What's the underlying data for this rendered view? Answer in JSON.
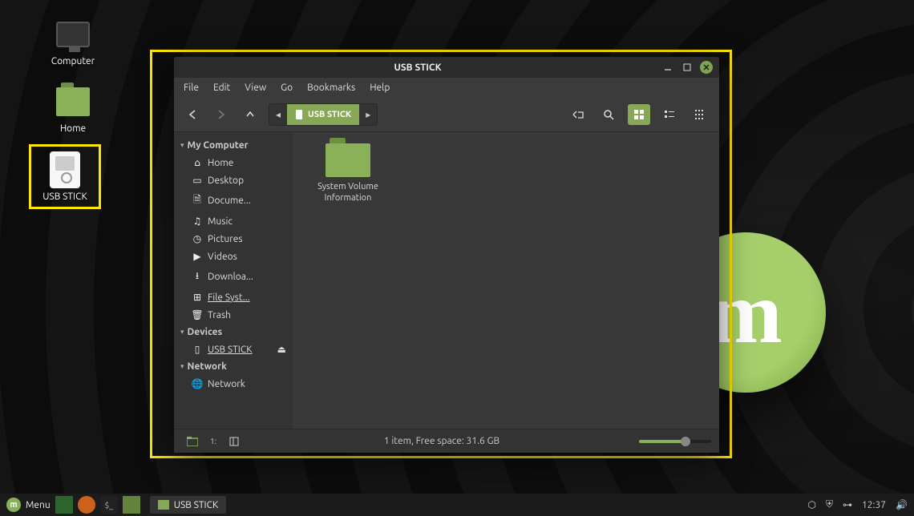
{
  "desktop": {
    "icons": [
      {
        "id": "computer",
        "label": "Computer"
      },
      {
        "id": "home",
        "label": "Home"
      },
      {
        "id": "usb",
        "label": "USB STICK"
      }
    ]
  },
  "window": {
    "title": "USB STICK",
    "menubar": [
      "File",
      "Edit",
      "View",
      "Go",
      "Bookmarks",
      "Help"
    ],
    "path_crumb": "USB STICK",
    "sidebar": {
      "sections": [
        {
          "title": "My Computer",
          "items": [
            {
              "icon": "home",
              "label": "Home"
            },
            {
              "icon": "desktop",
              "label": "Desktop"
            },
            {
              "icon": "doc",
              "label": "Docume..."
            },
            {
              "icon": "music",
              "label": "Music"
            },
            {
              "icon": "pic",
              "label": "Pictures"
            },
            {
              "icon": "vid",
              "label": "Videos"
            },
            {
              "icon": "dl",
              "label": "Downloa..."
            },
            {
              "icon": "fs",
              "label": "File Syst...",
              "underline": true
            },
            {
              "icon": "trash",
              "label": "Trash"
            }
          ]
        },
        {
          "title": "Devices",
          "items": [
            {
              "icon": "usb",
              "label": "USB STICK",
              "active": true,
              "eject": true
            }
          ]
        },
        {
          "title": "Network",
          "items": [
            {
              "icon": "net",
              "label": "Network"
            }
          ]
        }
      ]
    },
    "content": {
      "items": [
        {
          "label_line1": "System Volume",
          "label_line2": "Information"
        }
      ]
    },
    "status": "1 item, Free space: 31.6 GB"
  },
  "panel": {
    "menu_label": "Menu",
    "task_label": "USB STICK",
    "clock": "12:37"
  }
}
